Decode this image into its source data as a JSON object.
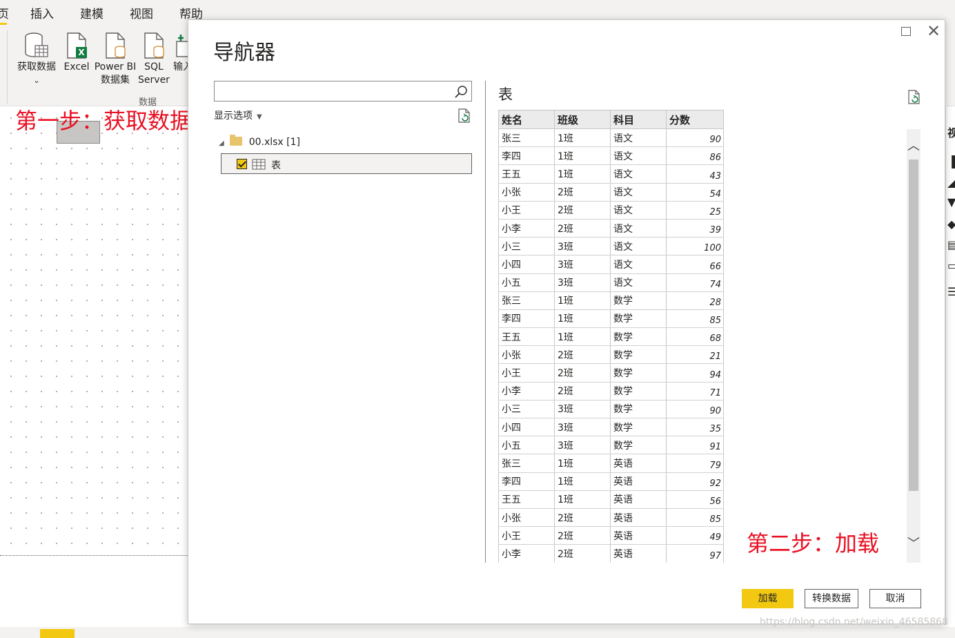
{
  "ribbon": {
    "tabs": [
      "页",
      "插入",
      "建模",
      "视图",
      "帮助"
    ],
    "buttons": {
      "get_data": "获取数据",
      "excel": "Excel",
      "powerbi_line1": "Power BI",
      "powerbi_line2": "数据集",
      "sql_line1": "SQL",
      "sql_line2": "Server",
      "input_partial": "输入"
    },
    "group_label": "数据"
  },
  "annotations": {
    "step1": "第一步：获取数据",
    "step2": "第二步：加载"
  },
  "navigator": {
    "title": "导航器",
    "search": {
      "value": "",
      "placeholder": ""
    },
    "display_options": "显示选项",
    "tree": {
      "file": "00.xlsx [1]",
      "item": "表",
      "item_checked": true
    },
    "preview": {
      "title": "表",
      "columns": [
        "姓名",
        "班级",
        "科目",
        "分数"
      ],
      "rows": [
        [
          "张三",
          "1班",
          "语文",
          "90"
        ],
        [
          "李四",
          "1班",
          "语文",
          "86"
        ],
        [
          "王五",
          "1班",
          "语文",
          "43"
        ],
        [
          "小张",
          "2班",
          "语文",
          "54"
        ],
        [
          "小王",
          "2班",
          "语文",
          "25"
        ],
        [
          "小李",
          "2班",
          "语文",
          "39"
        ],
        [
          "小三",
          "3班",
          "语文",
          "100"
        ],
        [
          "小四",
          "3班",
          "语文",
          "66"
        ],
        [
          "小五",
          "3班",
          "语文",
          "74"
        ],
        [
          "张三",
          "1班",
          "数学",
          "28"
        ],
        [
          "李四",
          "1班",
          "数学",
          "85"
        ],
        [
          "王五",
          "1班",
          "数学",
          "68"
        ],
        [
          "小张",
          "2班",
          "数学",
          "21"
        ],
        [
          "小王",
          "2班",
          "数学",
          "94"
        ],
        [
          "小李",
          "2班",
          "数学",
          "71"
        ],
        [
          "小三",
          "3班",
          "数学",
          "90"
        ],
        [
          "小四",
          "3班",
          "数学",
          "35"
        ],
        [
          "小五",
          "3班",
          "数学",
          "91"
        ],
        [
          "张三",
          "1班",
          "英语",
          "79"
        ],
        [
          "李四",
          "1班",
          "英语",
          "92"
        ],
        [
          "王五",
          "1班",
          "英语",
          "56"
        ],
        [
          "小张",
          "2班",
          "英语",
          "85"
        ],
        [
          "小王",
          "2班",
          "英语",
          "49"
        ],
        [
          "小李",
          "2班",
          "英语",
          "97"
        ]
      ]
    },
    "buttons": {
      "load": "加载",
      "transform": "转换数据",
      "cancel": "取消"
    }
  },
  "watermark": "https://blog.csdn.net/weixin_46585868",
  "colors": {
    "accent": "#f2c811",
    "annotation": "#e81123"
  }
}
